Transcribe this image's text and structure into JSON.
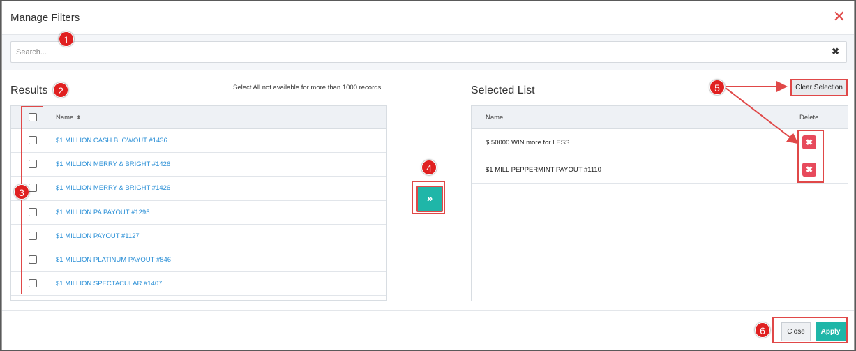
{
  "dialog": {
    "title": "Manage Filters",
    "close_icon": "close-icon"
  },
  "search": {
    "placeholder": "Search...",
    "value": "",
    "clear_icon": "clear-icon"
  },
  "results": {
    "title": "Results",
    "note": "Select All not available for more than 1000 records",
    "column_name": "Name",
    "sort_icon": "sort-icon",
    "rows": [
      {
        "name": "$1 MILLION CASH BLOWOUT #1436",
        "checked": false
      },
      {
        "name": "$1 MILLION MERRY & BRIGHT #1426",
        "checked": false
      },
      {
        "name": "$1 MILLION MERRY & BRIGHT #1426",
        "checked": false
      },
      {
        "name": "$1 MILLION PA PAYOUT #1295",
        "checked": false
      },
      {
        "name": "$1 MILLION PAYOUT #1127",
        "checked": false
      },
      {
        "name": "$1 MILLION PLATINUM PAYOUT #846",
        "checked": false
      },
      {
        "name": "$1 MILLION SPECTACULAR #1407",
        "checked": false
      }
    ]
  },
  "move_button": {
    "icon": "double-chevron-right-icon",
    "glyph": "»"
  },
  "selected": {
    "title": "Selected List",
    "column_name": "Name",
    "column_delete": "Delete",
    "clear_label": "Clear Selection",
    "rows": [
      {
        "name": "$ 50000 WIN more for LESS"
      },
      {
        "name": "$1 MILL PEPPERMINT PAYOUT #1110"
      }
    ]
  },
  "footer": {
    "close_label": "Close",
    "apply_label": "Apply"
  },
  "callouts": [
    "1",
    "2",
    "3",
    "4",
    "5",
    "6"
  ],
  "colors": {
    "accent": "#1fb6a8",
    "link": "#2a8fd6",
    "delete": "#e74a5c",
    "highlight": "#e04848"
  }
}
